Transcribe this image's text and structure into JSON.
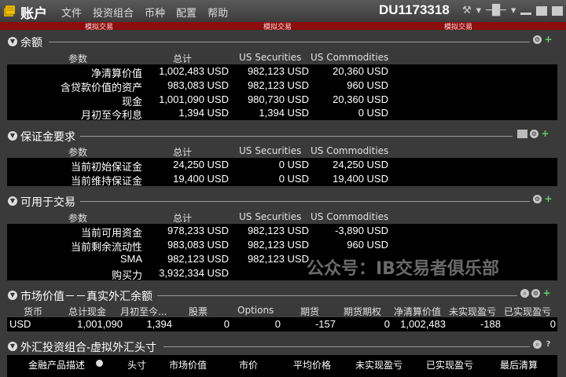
{
  "window": {
    "title": "账户",
    "account_id": "DU1173318",
    "menu": [
      "文件",
      "投资组合",
      "币种",
      "配置",
      "帮助"
    ]
  },
  "simulated_label": "模拟交易",
  "balances": {
    "title": "余额",
    "columns": [
      "参数",
      "总计",
      "US Securities",
      "US Commodities"
    ],
    "rows": [
      [
        "净清算价值",
        "1,002,483 USD",
        "982,123 USD",
        "20,360 USD"
      ],
      [
        "含贷款价值的资产",
        "983,083 USD",
        "982,123 USD",
        "960 USD"
      ],
      [
        "现金",
        "1,001,090 USD",
        "980,730 USD",
        "20,360 USD"
      ],
      [
        "月初至今利息",
        "1,394 USD",
        "1,394 USD",
        "0 USD"
      ]
    ]
  },
  "margin": {
    "title": "保证金要求",
    "columns": [
      "参数",
      "总计",
      "US Securities",
      "US Commodities"
    ],
    "rows": [
      [
        "当前初始保证金",
        "24,250 USD",
        "0 USD",
        "24,250 USD"
      ],
      [
        "当前维持保证金",
        "19,400 USD",
        "0 USD",
        "19,400 USD"
      ]
    ]
  },
  "trading": {
    "title": "可用于交易",
    "columns": [
      "参数",
      "总计",
      "US Securities",
      "US Commodities"
    ],
    "rows": [
      [
        "当前可用资金",
        "978,233 USD",
        "982,123 USD",
        "-3,890 USD"
      ],
      [
        "当前剩余流动性",
        "983,083 USD",
        "982,123 USD",
        "960 USD"
      ],
      [
        "SMA",
        "982,123 USD",
        "982,123 USD",
        ""
      ],
      [
        "购买力",
        "3,932,334 USD",
        "",
        ""
      ]
    ]
  },
  "watermark": "公众号：IB交易者俱乐部",
  "market_value": {
    "title": "市场价值－－真实外汇余额",
    "columns": [
      "货币",
      "总计现金",
      "月初至今...",
      "股票",
      "Options",
      "期货",
      "期货期权",
      "净清算价值",
      "未实现盈亏",
      "已实现盈亏"
    ],
    "row": [
      "USD",
      "1,001,090",
      "1,394",
      "0",
      "0",
      "-157",
      "0",
      "1,002,483",
      "-188",
      "0"
    ]
  },
  "fx_portfolio": {
    "title": "外汇投资组合-虚拟外汇头寸",
    "columns": [
      "金融产品描述",
      "头寸",
      "市场价值",
      "市价",
      "平均价格",
      "未实现盈亏",
      "已实现盈亏",
      "最后清算"
    ]
  }
}
